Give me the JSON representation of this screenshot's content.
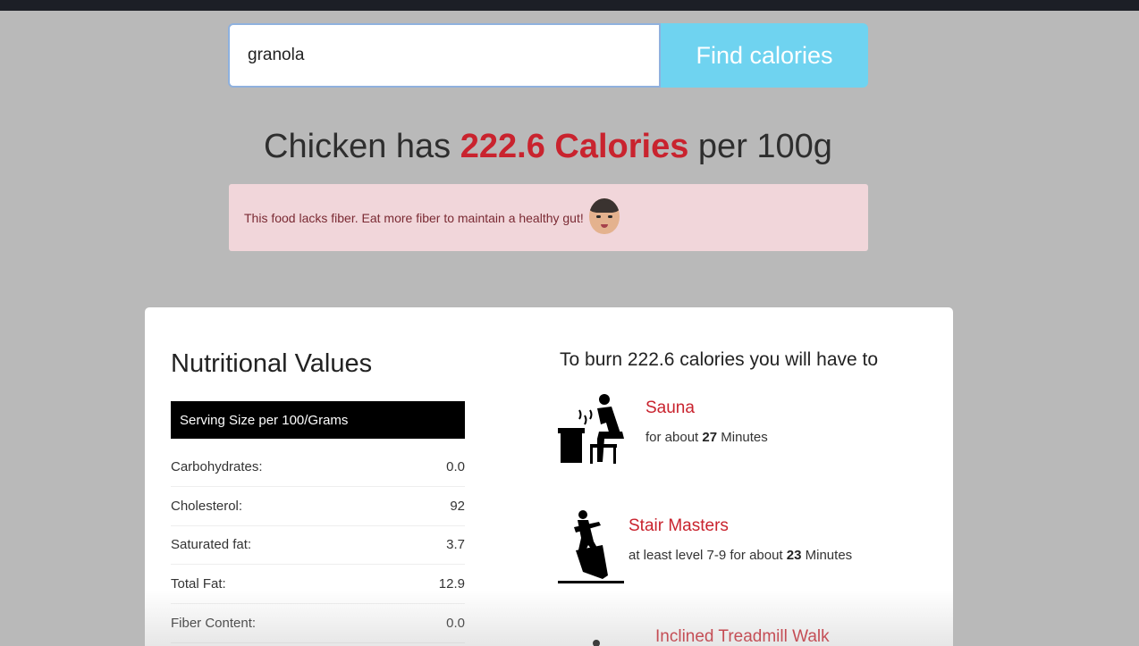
{
  "search": {
    "value": "granola",
    "button_label": "Find calories"
  },
  "headline": {
    "food": "Chicken",
    "has": "has",
    "calories_text": "222.6 Calories",
    "per": "per 100g"
  },
  "alert": {
    "message": "This food lacks fiber. Eat more fiber to maintain a healthy gut!",
    "icon": "face-emoji-icon"
  },
  "nutrition": {
    "title": "Nutritional Values",
    "serving_label": "Serving Size per 100/Grams",
    "rows": [
      {
        "label": "Carbohydrates:",
        "value": "0.0"
      },
      {
        "label": "Cholesterol:",
        "value": "92"
      },
      {
        "label": "Saturated fat:",
        "value": "3.7"
      },
      {
        "label": "Total Fat:",
        "value": "12.9"
      },
      {
        "label": "Fiber Content:",
        "value": "0.0"
      }
    ]
  },
  "burn": {
    "title": "To burn 222.6 calories you will have to",
    "activities": [
      {
        "name": "Sauna",
        "desc_prefix": "for about",
        "minutes": "27",
        "desc_suffix": "Minutes",
        "icon": "sauna-icon"
      },
      {
        "name": "Stair Masters",
        "desc_prefix": "at least level 7-9 for about",
        "minutes": "23",
        "desc_suffix": "Minutes",
        "icon": "stair-master-icon"
      },
      {
        "name": "Inclined Treadmill Walk",
        "icon": "treadmill-icon"
      }
    ]
  },
  "colors": {
    "accent_red": "#c9232e",
    "button_blue": "#6fd3f0",
    "alert_bg": "#f1d6da"
  }
}
